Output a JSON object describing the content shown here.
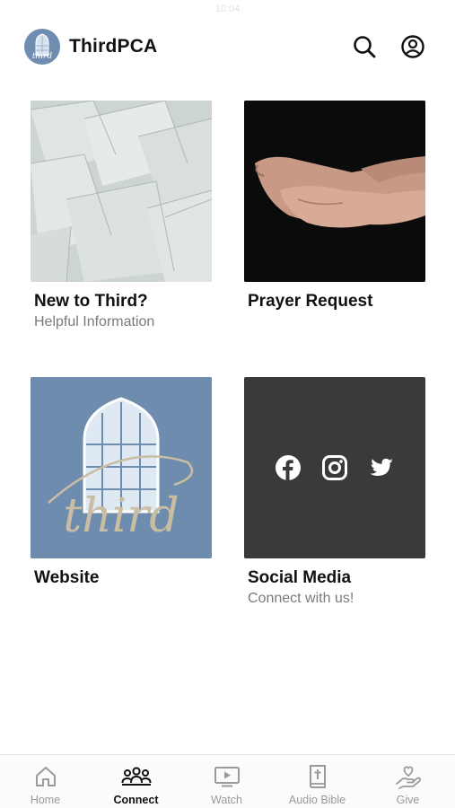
{
  "status_bar": {
    "time": "10:04"
  },
  "header": {
    "app_title": "ThirdPCA",
    "logo_text": "third"
  },
  "tiles": [
    {
      "title": "New to Third?",
      "subtitle": "Helpful Information",
      "image": "torn-paper-photo"
    },
    {
      "title": "Prayer Request",
      "subtitle": "",
      "image": "open-hands-photo"
    },
    {
      "title": "Website",
      "subtitle": "",
      "image": "third-church-window-logo",
      "logo_text": "third"
    },
    {
      "title": "Social Media",
      "subtitle": "Connect with us!",
      "icons": [
        "facebook-icon",
        "instagram-icon",
        "twitter-icon"
      ]
    }
  ],
  "tabbar": {
    "active": "Connect",
    "items": [
      {
        "label": "Home",
        "icon": "home-icon"
      },
      {
        "label": "Connect",
        "icon": "people-icon"
      },
      {
        "label": "Watch",
        "icon": "tv-play-icon"
      },
      {
        "label": "Audio Bible",
        "icon": "bible-cross-icon"
      },
      {
        "label": "Give",
        "icon": "heart-hand-icon"
      }
    ]
  },
  "colors": {
    "website_bg": "#6e8cad",
    "social_bg": "#3a3a3a",
    "active_tab": "#111111",
    "inactive_tab": "#9a9a9a"
  }
}
